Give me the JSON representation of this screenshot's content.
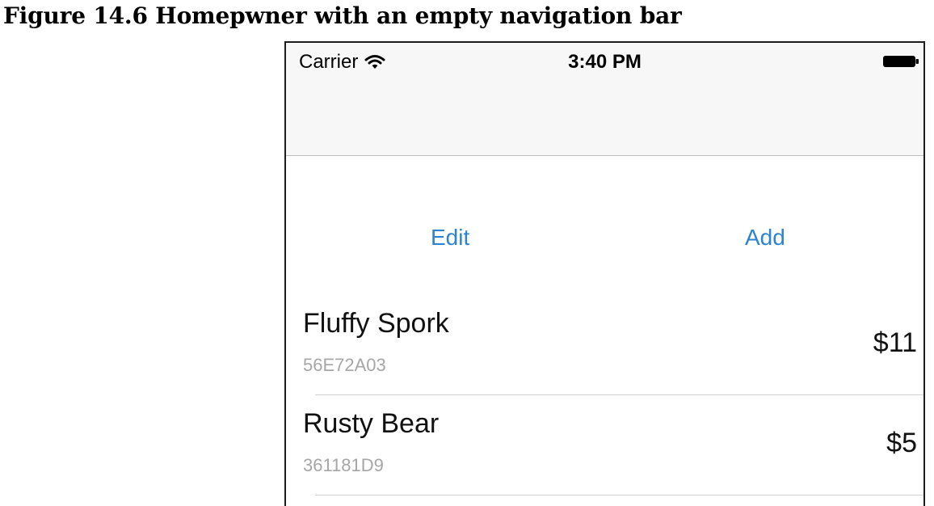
{
  "caption": "Figure 14.6  Homepwner with an empty navigation bar",
  "status_bar": {
    "carrier": "Carrier",
    "time": "3:40 PM",
    "wifi_icon": "wifi-icon",
    "battery_icon": "battery-icon"
  },
  "toolbar": {
    "edit_label": "Edit",
    "add_label": "Add"
  },
  "items": [
    {
      "name": "Fluffy Spork",
      "serial": "56E72A03",
      "value": "$11"
    },
    {
      "name": "Rusty Bear",
      "serial": "361181D9",
      "value": "$5"
    }
  ],
  "colors": {
    "accent": "#2e83d1",
    "nav_background": "#f7f7f7",
    "serial_text": "#a6a6a6"
  }
}
